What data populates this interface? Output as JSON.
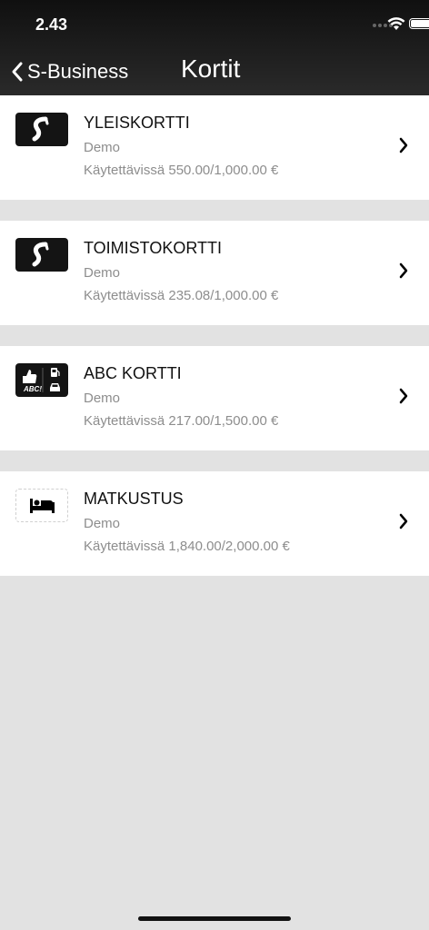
{
  "status_bar": {
    "time": "2.43"
  },
  "nav": {
    "back_label": "S-Business",
    "title": "Kortit"
  },
  "cards": [
    {
      "name": "YLEISKORTTI",
      "subtitle": "Demo",
      "availability": "Käytettävissä 550.00/1,000.00 €",
      "logo_icon": "s-logo-icon"
    },
    {
      "name": "TOIMISTOKORTTI",
      "subtitle": "Demo",
      "availability": "Käytettävissä 235.08/1,000.00 €",
      "logo_icon": "s-logo-icon"
    },
    {
      "name": "ABC KORTTI",
      "subtitle": "Demo",
      "availability": "Käytettävissä 217.00/1,500.00 €",
      "logo_icon": "abc-card-icon",
      "logo_text": "ABC!"
    },
    {
      "name": "MATKUSTUS",
      "subtitle": "Demo",
      "availability": "Käytettävissä 1,840.00/2,000.00 €",
      "logo_icon": "bed-icon"
    }
  ],
  "colors": {
    "header_bg": "#1a1a1a",
    "background": "#e2e2e2",
    "row_bg": "#ffffff",
    "secondary_text": "#8d8d8d"
  }
}
